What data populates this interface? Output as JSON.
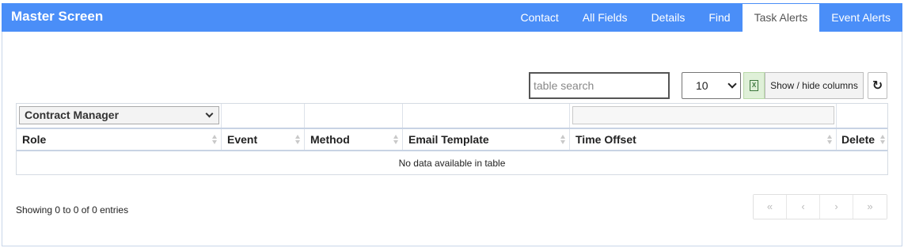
{
  "app": {
    "title": "Master Screen"
  },
  "tabs": [
    {
      "label": "Contact",
      "active": false
    },
    {
      "label": "All Fields",
      "active": false
    },
    {
      "label": "Details",
      "active": false
    },
    {
      "label": "Find",
      "active": false
    },
    {
      "label": "Task Alerts",
      "active": true
    },
    {
      "label": "Event Alerts",
      "active": false
    }
  ],
  "toolbar": {
    "search_placeholder": "table search",
    "search_value": "",
    "page_size": "10",
    "excel_icon": "excel-export-icon",
    "colvis_label": "Show / hide columns",
    "refresh_icon": "↻"
  },
  "table": {
    "role_filter": "Contract Manager",
    "columns": [
      "Role",
      "Event",
      "Method",
      "Email Template",
      "Time Offset",
      "Delete"
    ],
    "empty_message": "No data available in table"
  },
  "footer": {
    "info": "Showing 0 to 0 of 0 entries",
    "pager": [
      "«",
      "‹",
      "›",
      "»"
    ]
  },
  "colors": {
    "topbar": "#4a8ef8",
    "excel_button": "#dff0d8"
  }
}
